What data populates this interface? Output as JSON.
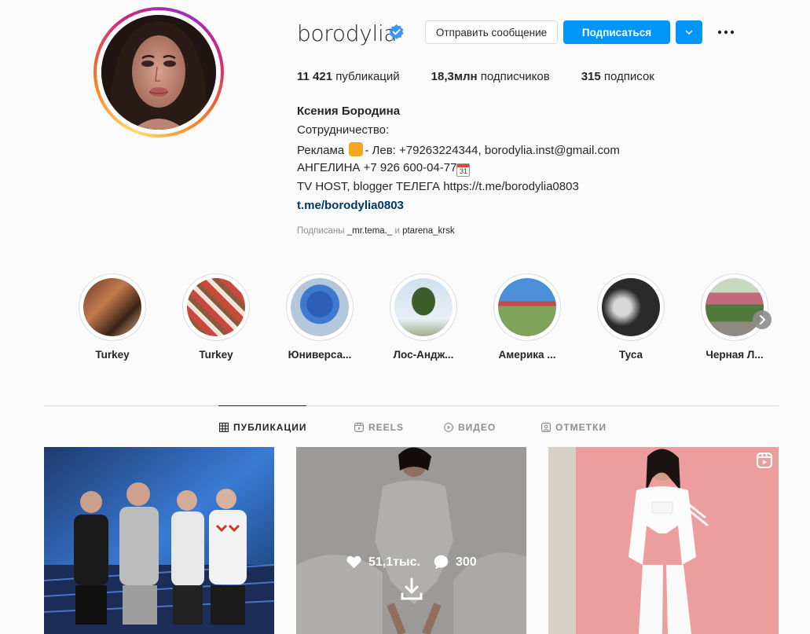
{
  "profile": {
    "username": "borodylia",
    "buttons": {
      "message": "Отправить сообщение",
      "follow": "Подписаться"
    },
    "stats": [
      {
        "value": "11 421",
        "label": "публикаций"
      },
      {
        "value": "18,3млн",
        "label": "подписчиков"
      },
      {
        "value": "315",
        "label": "подписок"
      }
    ],
    "full_name": "Ксения Бородина",
    "bio": {
      "line1": "Сотрудничество:",
      "line2_prefix": "Реклама ",
      "line2_suffix": "- Лев: +79263224344, borodylia.inst@gmail.com",
      "line3": "АНГЕЛИНА +7 926 600-04-77",
      "line3_cal": "31",
      "line4": "TV HOST, blogger ТЕЛЕГА https://t.me/borodylia0803",
      "link": "t.me/borodylia0803"
    },
    "followed_by": {
      "prefix": "Подписаны ",
      "user1": "_mr.tema._",
      "join": " и ",
      "user2": "ptarena_krsk"
    }
  },
  "highlights": [
    {
      "label": "Turkey"
    },
    {
      "label": "Turkey"
    },
    {
      "label": "Юниверса..."
    },
    {
      "label": "Лос-Андж..."
    },
    {
      "label": "Америка ..."
    },
    {
      "label": "Туса"
    },
    {
      "label": "Черная Л..."
    }
  ],
  "tabs": [
    {
      "label": "ПУБЛИКАЦИИ",
      "active": true
    },
    {
      "label": "REELS",
      "active": false
    },
    {
      "label": "ВИДЕО",
      "active": false
    },
    {
      "label": "ОТМЕТКИ",
      "active": false
    }
  ],
  "posts": {
    "hover": {
      "likes": "51,1тыс.",
      "comments": "300"
    }
  },
  "colors": {
    "accent": "#0095f6",
    "link": "#00376b",
    "text": "#262626",
    "muted": "#8e8e8e",
    "verified": "#3897f0"
  },
  "icons": [
    "verified-badge-icon",
    "chevron-down-icon",
    "more-options-icon",
    "grid-icon",
    "reels-icon",
    "video-icon",
    "tagged-icon",
    "heart-icon",
    "comment-icon",
    "download-icon",
    "reels-badge-icon",
    "chevron-right-icon"
  ]
}
